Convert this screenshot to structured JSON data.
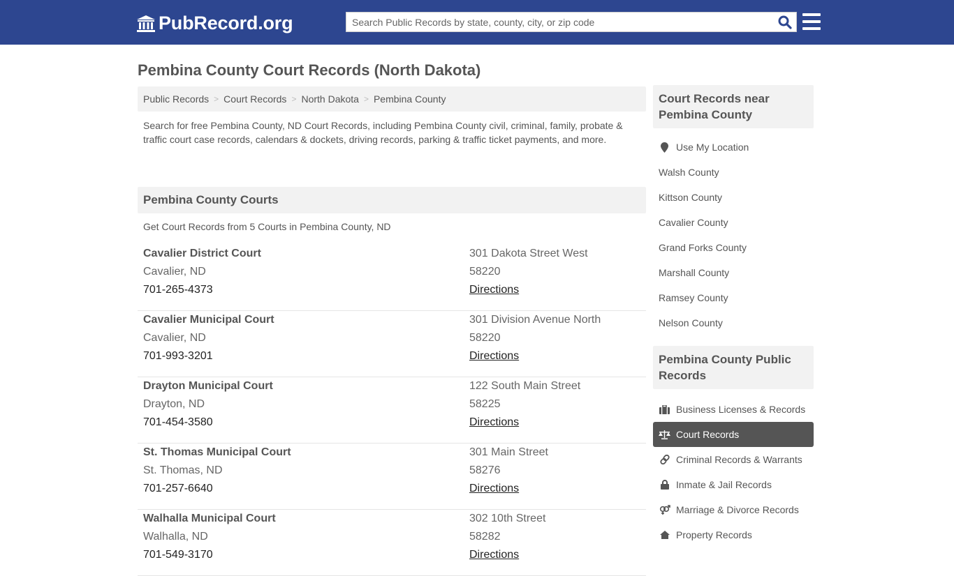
{
  "header": {
    "logo_text": "PubRecord.org",
    "search_placeholder": "Search Public Records by state, county, city, or zip code",
    "colors": {
      "brand": "#2d4690",
      "search_icon": "#2d4690"
    }
  },
  "page_title": "Pembina County Court Records (North Dakota)",
  "breadcrumb": [
    {
      "label": "Public Records"
    },
    {
      "label": "Court Records"
    },
    {
      "label": "North Dakota"
    },
    {
      "label": "Pembina County"
    }
  ],
  "intro": "Search for free Pembina County, ND Court Records, including Pembina County civil, criminal, family, probate & traffic court case records, calendars & dockets, driving records, parking & traffic ticket payments, and more.",
  "courts_section": {
    "title": "Pembina County Courts",
    "subtitle": "Get Court Records from 5 Courts in Pembina County, ND",
    "directions_label": "Directions",
    "courts": [
      {
        "name": "Cavalier District Court",
        "city": "Cavalier, ND",
        "phone": "701-265-4373",
        "address": "301 Dakota Street West",
        "zip": "58220",
        "directions": "Directions"
      },
      {
        "name": "Cavalier Municipal Court",
        "city": "Cavalier, ND",
        "phone": "701-993-3201",
        "address": "301 Division Avenue North",
        "zip": "58220",
        "directions": "Directions"
      },
      {
        "name": "Drayton Municipal Court",
        "city": "Drayton, ND",
        "phone": "701-454-3580",
        "address": "122 South Main Street",
        "zip": "58225",
        "directions": "Directions"
      },
      {
        "name": "St. Thomas Municipal Court",
        "city": "St. Thomas, ND",
        "phone": "701-257-6640",
        "address": "301 Main Street",
        "zip": "58276",
        "directions": "Directions"
      },
      {
        "name": "Walhalla Municipal Court",
        "city": "Walhalla, ND",
        "phone": "701-549-3170",
        "address": "302 10th Street",
        "zip": "58282",
        "directions": "Directions"
      }
    ]
  },
  "sidebar": {
    "nearby": {
      "title": "Court Records near Pembina County",
      "use_location": {
        "label": "Use My Location",
        "icon": "map-marker-icon"
      },
      "items": [
        {
          "label": "Walsh County"
        },
        {
          "label": "Kittson County"
        },
        {
          "label": "Cavalier County"
        },
        {
          "label": "Grand Forks County"
        },
        {
          "label": "Marshall County"
        },
        {
          "label": "Ramsey County"
        },
        {
          "label": "Nelson County"
        }
      ]
    },
    "public_records": {
      "title": "Pembina County Public Records",
      "items": [
        {
          "label": "Business Licenses & Records",
          "icon": "briefcase-icon",
          "active": false
        },
        {
          "label": "Court Records",
          "icon": "balance-scale-icon",
          "active": true
        },
        {
          "label": "Criminal Records & Warrants",
          "icon": "link-icon",
          "active": false
        },
        {
          "label": "Inmate & Jail Records",
          "icon": "lock-icon",
          "active": false
        },
        {
          "label": "Marriage & Divorce Records",
          "icon": "venus-mars-icon",
          "active": false
        },
        {
          "label": "Property Records",
          "icon": "home-icon",
          "active": false
        }
      ]
    }
  }
}
